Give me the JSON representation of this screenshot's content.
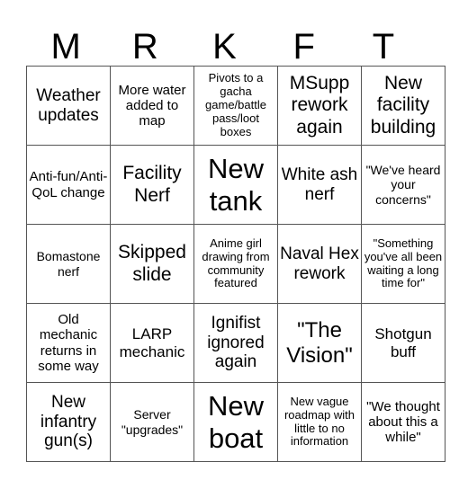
{
  "header": {
    "letters": [
      "M",
      "R",
      "K",
      "F",
      "T"
    ]
  },
  "board": {
    "rows": [
      [
        "Weather updates",
        "More water added to map",
        "Pivots to a gacha game/battle pass/loot boxes",
        "MSupp rework again",
        "New facility building"
      ],
      [
        "Anti-fun/Anti-QoL change",
        "Facility Nerf",
        "New tank",
        "White ash nerf",
        "\"We've heard your concerns\""
      ],
      [
        "Bomastone nerf",
        "Skipped slide",
        "Anime girl drawing from community featured",
        "Naval Hex rework",
        "\"Something you've all been waiting a long time for\""
      ],
      [
        "Old mechanic returns in some way",
        "LARP mechanic",
        "Ignifist ignored again",
        "\"The Vision\"",
        "Shotgun buff"
      ],
      [
        "New infantry gun(s)",
        "Server \"upgrades\"",
        "New boat",
        "New vague roadmap with little to no information",
        "\"We thought about this a while\""
      ]
    ]
  }
}
